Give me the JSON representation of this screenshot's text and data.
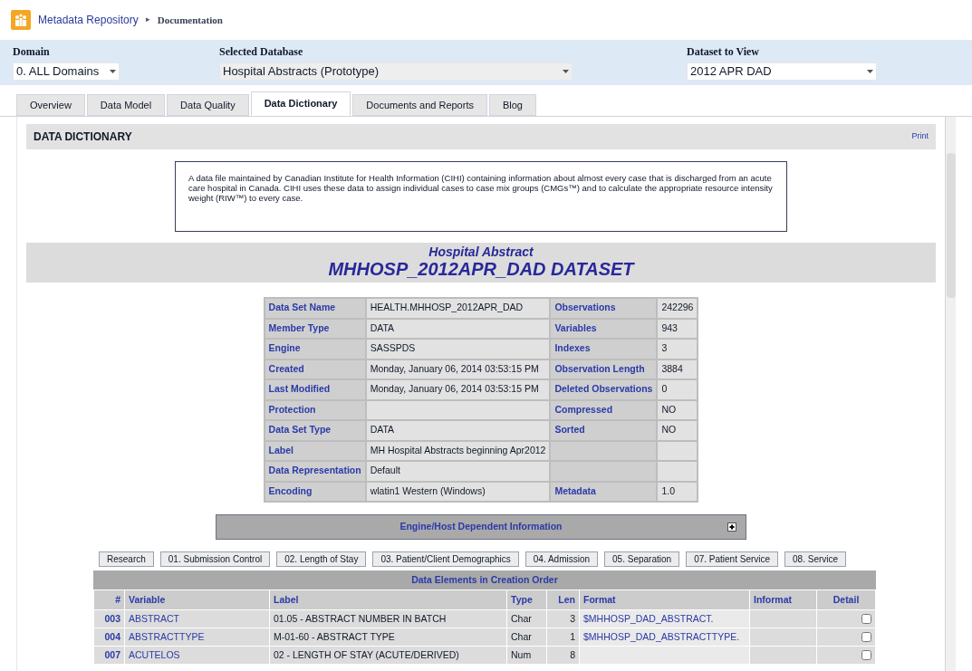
{
  "breadcrumb": {
    "app": "Metadata Repository",
    "separator": "▸",
    "page": "Documentation"
  },
  "selectors": [
    {
      "label": "Domain",
      "value": "0. ALL Domains"
    },
    {
      "label": "Selected Database",
      "value": "Hospital Abstracts (Prototype)"
    },
    {
      "label": "Dataset to View",
      "value": "2012 APR DAD"
    }
  ],
  "tabs": [
    {
      "label": "Overview",
      "selected": false
    },
    {
      "label": "Data Model",
      "selected": false
    },
    {
      "label": "Data Quality",
      "selected": false
    },
    {
      "label": "Data Dictionary",
      "selected": true
    },
    {
      "label": "Documents and Reports",
      "selected": false
    },
    {
      "label": "Blog",
      "selected": false
    }
  ],
  "section": {
    "title": "DATA DICTIONARY",
    "print": "Print"
  },
  "description": "A data file maintained by Canadian Institute for Health Information (CIHI) containing information about almost every case that is discharged from an acute care hospital in Canada. CIHI uses these data to assign individual cases to case mix groups (CMGs™) and to calculate the appropriate resource intensity weight (RIW™) to every case.",
  "dataset": {
    "subtitle": "Hospital Abstract",
    "title": "MHHOSP_2012APR_DAD DATASET"
  },
  "properties": [
    {
      "name": "Data Set Name",
      "value": "HEALTH.MHHOSP_2012APR_DAD",
      "name_2": "Observations",
      "value_2": "242296"
    },
    {
      "name": "Member Type",
      "value": "DATA",
      "name_2": "Variables",
      "value_2": "943"
    },
    {
      "name": "Engine",
      "value": "SASSPDS",
      "name_2": "Indexes",
      "value_2": "3"
    },
    {
      "name": "Created",
      "value": "Monday, January 06, 2014 03:53:15 PM",
      "name_2": "Observation Length",
      "value_2": "3884"
    },
    {
      "name": "Last Modified",
      "value": "Monday, January 06, 2014 03:53:15 PM",
      "name_2": "Deleted Observations",
      "value_2": "0"
    },
    {
      "name": "Protection",
      "name_2": "Compressed",
      "value_2": "NO"
    },
    {
      "name": "Data Set Type",
      "value": "DATA",
      "name_2": "Sorted",
      "value_2": "NO"
    },
    {
      "name": "Label",
      "value": "MH Hospital Abstracts beginning Apr2012"
    },
    {
      "name": "Data Representation",
      "value": "Default"
    },
    {
      "name": "Encoding",
      "value": "wlatin1 Western (Windows)",
      "name_2": "Metadata",
      "value_2": "1.0"
    }
  ],
  "engine_panel": {
    "title": "Engine/Host Dependent Information",
    "expanded": false
  },
  "category_buttons": [
    "Research",
    "01. Submission Control",
    "02. Length of Stay",
    "03. Patient/Client Demographics",
    "04. Admission",
    "05. Separation",
    "07. Patient Service",
    "08. Service"
  ],
  "elements_table": {
    "title": "Data Elements in Creation Order",
    "columns": [
      "#",
      "Variable",
      "Label",
      "Type",
      "Len",
      "Format",
      "Informat",
      "Detail"
    ],
    "rows": [
      {
        "num": "003",
        "variable": "ABSTRACT",
        "label": "01.05 - ABSTRACT NUMBER IN BATCH",
        "type": "Char",
        "len": "3",
        "format": "$MHHOSP_DAD_ABSTRACT.",
        "checked": false
      },
      {
        "num": "004",
        "variable": "ABSTRACTTYPE",
        "label": "M-01-60 - ABSTRACT TYPE",
        "type": "Char",
        "len": "1",
        "format": "$MHHOSP_DAD_ABSTRACTTYPE.",
        "checked": false
      },
      {
        "num": "007",
        "variable": "ACUTELOS",
        "label": "02 - LENGTH OF STAY (ACUTE/DERIVED)",
        "type": "Num",
        "len": "8",
        "format": "",
        "checked": false
      }
    ]
  }
}
